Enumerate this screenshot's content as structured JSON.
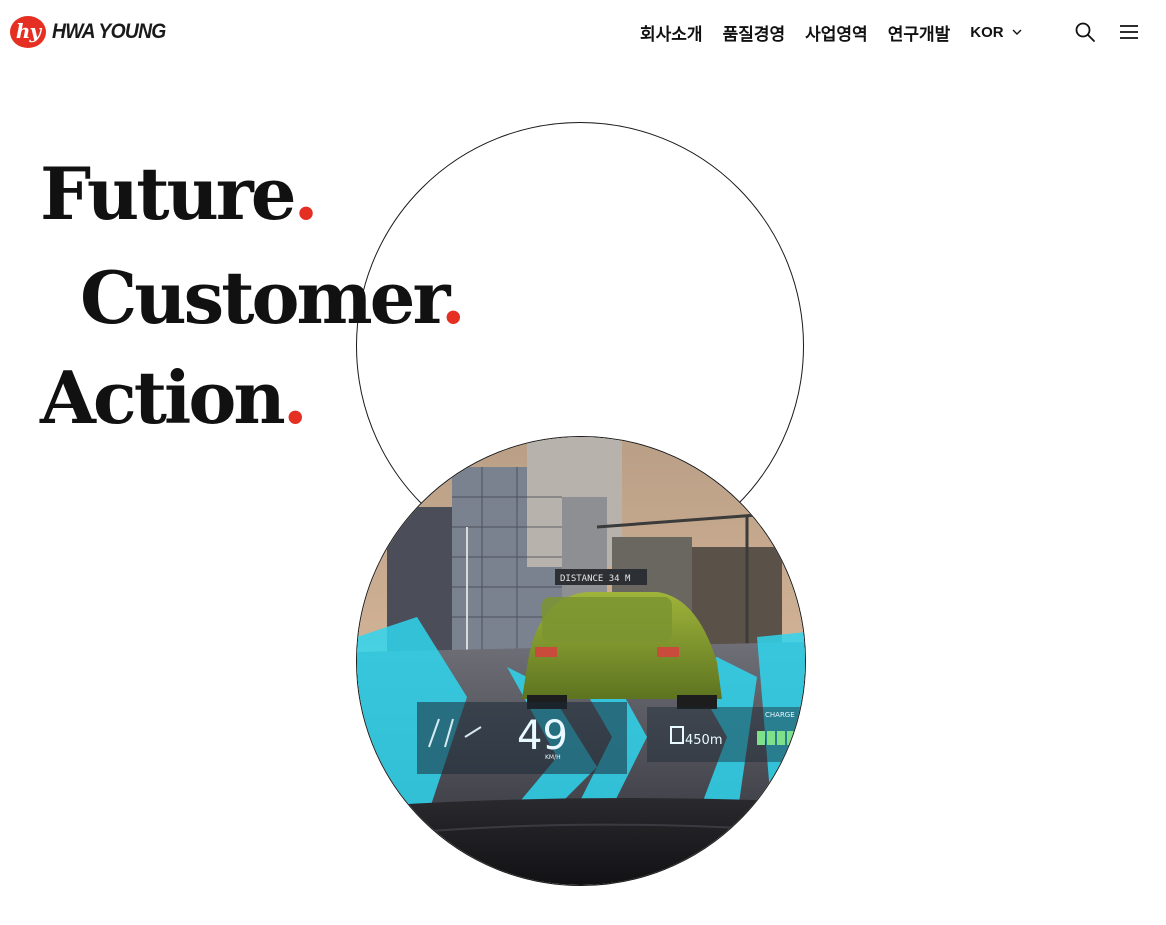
{
  "brand": {
    "logo_mark": "hy",
    "name": "HWA YOUNG",
    "accent": "#e52f22"
  },
  "nav": {
    "items": [
      "회사소개",
      "품질경영",
      "사업영역",
      "연구개발"
    ],
    "language": "KOR"
  },
  "icons": {
    "search": "search-icon",
    "menu": "hamburger-menu-icon",
    "lang_dropdown": "chevron-down-icon"
  },
  "hero": {
    "lines": [
      {
        "word": "Future",
        "dot": "."
      },
      {
        "word": "Customer",
        "dot": "."
      },
      {
        "word": "Action",
        "dot": "."
      }
    ]
  },
  "hud": {
    "distance": "DISTANCE  34 M",
    "speed": "49",
    "speed_unit": "KM/H",
    "range": "450m",
    "charge": "CHARGE"
  }
}
